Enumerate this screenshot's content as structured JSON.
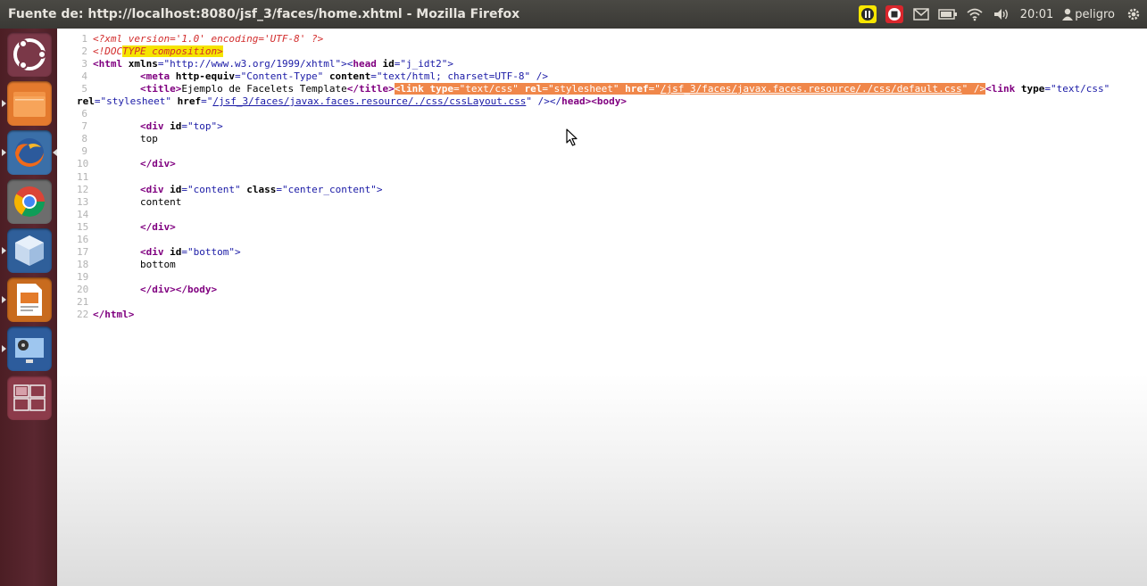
{
  "window": {
    "title": "Fuente de: http://localhost:8080/jsf_3/faces/home.xhtml - Mozilla Firefox"
  },
  "tray": {
    "icons": [
      "pause-icon",
      "stop-record-icon",
      "mail-icon",
      "battery-icon",
      "wifi-icon",
      "volume-icon"
    ],
    "clock": "20:01",
    "user": "peligro",
    "accent_yellow": "#f7e600",
    "record_red": "#d9262c"
  },
  "launcher": {
    "items": [
      "ubuntu-dash-icon",
      "files-icon",
      "firefox-icon",
      "chrome-icon",
      "virtualbox-icon",
      "impress-icon",
      "video-editor-icon",
      "workspace-switcher-icon"
    ]
  },
  "source": {
    "l1": "<?xml version='1.0' encoding='UTF-8' ?>",
    "l2a": "<!DOC",
    "l2b": "TYPE",
    "l2c": " composition>",
    "l3a": "<html ",
    "l3b": "xmlns",
    "l3c": "=\"http://www.w3.org/1999/xhtml\"><",
    "l3d": "head ",
    "l3e": "id",
    "l3f": "=\"j_idt2\">",
    "l4a": "<meta ",
    "l4b": "http-equiv",
    "l4c": "=\"Content-Type\" ",
    "l4d": "content",
    "l4e": "=\"text/html; charset=UTF-8\" />",
    "l5a": "<title>",
    "l5b": "Ejemplo de Facelets Template",
    "l5c": "</title>",
    "l5d": "<link ",
    "l5e": "type",
    "l5f": "=\"text/css\" ",
    "l5g": "rel",
    "l5h": "=\"stylesheet\" ",
    "l5i": "href",
    "l5j": "=\"",
    "l5k": "/jsf_3/faces/javax.faces.resource/./css/default.css",
    "l5l": "\" />",
    "l5m": "<link ",
    "l5n": "type",
    "l5o": "=\"text/css\"",
    "l5p": "rel",
    "l5q": "=\"stylesheet\" ",
    "l5r": "href",
    "l5s": "=\"",
    "l5t": "/jsf_3/faces/javax.faces.resource/./css/cssLayout.css",
    "l5u": "\" /></",
    "l5v": "head",
    "l5w": "><",
    "l5x": "body",
    "l5y": ">",
    "l7a": "<div ",
    "l7b": "id",
    "l7c": "=\"top\">",
    "l8": "top",
    "l10": "</div>",
    "l12a": "<div ",
    "l12b": "id",
    "l12c": "=\"content\" ",
    "l12d": "class",
    "l12e": "=\"center_content\">",
    "l13": "content",
    "l15": "</div>",
    "l17a": "<div ",
    "l17b": "id",
    "l17c": "=\"bottom\">",
    "l18": "bottom",
    "l20": "</div></body>",
    "l22": "</html>"
  }
}
